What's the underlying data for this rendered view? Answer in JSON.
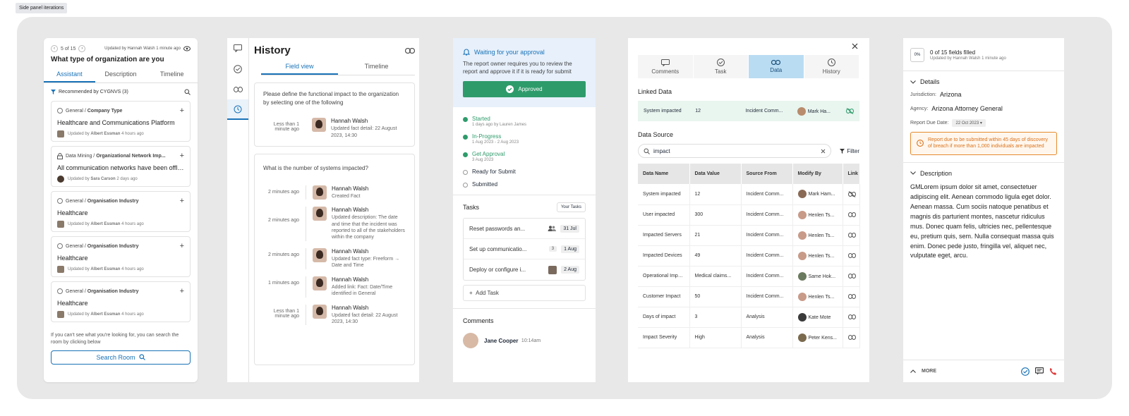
{
  "canvas": {
    "label": "Side panel iterations"
  },
  "panel1": {
    "pager": "5 of 15",
    "updated": "Updated by Hannah Walsh 1 minute ago",
    "title": "What type of organization are you",
    "tabs": [
      "Assistant",
      "Description",
      "Timeline"
    ],
    "recommended": "Recommended by CYGNVS (3)",
    "cards": [
      {
        "category": "General",
        "field": "Company Type",
        "value": "Healthcare and Communications Platform",
        "updated_prefix": "Updated by",
        "user": "Albert Essman",
        "when": "4 hours ago"
      },
      {
        "category": "Data Mining",
        "field": "Organizational Network Imp...",
        "value": "All communication networks have been offlin...",
        "updated_prefix": "Updated by",
        "user": "Sara Carson",
        "when": "2 days ago"
      },
      {
        "category": "General",
        "field": "Organisation Industry",
        "value": "Healthcare",
        "updated_prefix": "Updated by",
        "user": "Albert Essman",
        "when": "4 hours ago"
      },
      {
        "category": "General",
        "field": "Organisation Industry",
        "value": "Healthcare",
        "updated_prefix": "Updated by",
        "user": "Albert Essman",
        "when": "4 hours ago"
      },
      {
        "category": "General",
        "field": "Organisation Industry",
        "value": "Healthcare",
        "updated_prefix": "Updated by",
        "user": "Albert Essman",
        "when": "4 hours ago"
      }
    ],
    "footer_text": "If you can't see what you're looking for, you can search the room by clicking below",
    "search_room": "Search Room"
  },
  "panel2": {
    "title": "History",
    "tabs": [
      "Field view",
      "Timeline"
    ],
    "box1": {
      "question": "Please define the functional impact to the organization by selecting one of the following",
      "entries": [
        {
          "when": "Less than 1 minute ago",
          "name": "Hannah Walsh",
          "desc": "Updated fact detail: 22 August 2023, 14:30"
        }
      ]
    },
    "box2": {
      "question": "What is the number of systems impacted?",
      "entries": [
        {
          "when": "2 minutes ago",
          "name": "Hannah Walsh",
          "desc": "Created Fact"
        },
        {
          "when": "2 minutes ago",
          "name": "Hannah Walsh",
          "desc": "Updated description: The date and time that the incident was reported to all of the stakeholders within the company"
        },
        {
          "when": "2 minutes ago",
          "name": "Hannah Walsh",
          "desc": "Updated fact type: Freeform → Date and Time"
        },
        {
          "when": "1 minutes ago",
          "name": "Hannah Walsh",
          "desc": "Added link: Fact: Date/Time identified in General"
        },
        {
          "when": "Less than 1 minute ago",
          "name": "Hannah Walsh",
          "desc": "Updated fact detail: 22 August 2023, 14:30"
        }
      ]
    }
  },
  "panel3": {
    "wait_title": "Waiting for your approval",
    "wait_desc": "The report owner requires you to review the report and approve it if it is ready for submit",
    "approved": "Approved",
    "steps": [
      {
        "label": "Started",
        "sub": "1 days ago by Lauren James",
        "done": true
      },
      {
        "label": "In-Progress",
        "sub": "1 Aug 2023 - 2 Aug 2023",
        "done": true
      },
      {
        "label": "Get Approval",
        "sub": "3 Aug 2023",
        "done": true
      },
      {
        "label": "Ready for Submit",
        "sub": "",
        "done": false
      },
      {
        "label": "Submitted",
        "sub": "",
        "done": false
      }
    ],
    "tasks_title": "Tasks",
    "your_tasks": "Your Tasks",
    "tasks": [
      {
        "name": "Reset passwords an...",
        "meta": "",
        "date": "31 Jul"
      },
      {
        "name": "Set up communicatio...",
        "meta": "3",
        "date": "1 Aug"
      },
      {
        "name": "Deploy or configure i...",
        "meta": "",
        "date": "2 Aug"
      }
    ],
    "add_task": "Add Task",
    "comments_title": "Comments",
    "comment": {
      "name": "Jane Cooper",
      "time": "10:14am"
    }
  },
  "panel4": {
    "tabs": [
      "Comments",
      "Task",
      "Data",
      "History"
    ],
    "linked_title": "Linked Data",
    "linked": {
      "name": "System impacted",
      "value": "12",
      "source": "Incident Comm...",
      "user": "Mark Ha..."
    },
    "source_title": "Data Source",
    "search_value": "impact",
    "filter": "Filter",
    "columns": [
      "Data Name",
      "Data Value",
      "Source From",
      "Modify By",
      "Link"
    ],
    "rows": [
      {
        "name": "System impacted",
        "value": "12",
        "source": "Incident Comm...",
        "user": "Mark Ham..."
      },
      {
        "name": "User impacted",
        "value": "300",
        "source": "Incident Comm...",
        "user": "Henlen Ts..."
      },
      {
        "name": "Impacted Servers",
        "value": "21",
        "source": "Incident Comm...",
        "user": "Henlen Ts..."
      },
      {
        "name": "Impacted Devices",
        "value": "49",
        "source": "Incident Comm...",
        "user": "Henlen Ts..."
      },
      {
        "name": "Operational Impact",
        "value": "Medical claims...",
        "source": "Incident Comm...",
        "user": "Same Hok..."
      },
      {
        "name": "Customer Impact",
        "value": "50",
        "source": "Incident Comm...",
        "user": "Henlen Ts..."
      },
      {
        "name": "Days of impact",
        "value": "3",
        "source": "Analysis",
        "user": "Kate Mote"
      },
      {
        "name": "Impact Severity",
        "value": "High",
        "source": "Analysis",
        "user": "Peter Kens..."
      }
    ]
  },
  "panel5": {
    "pct": "0%",
    "filled": "0 of 15 fields filled",
    "updated": "Updated by Hannah Walsh 1 minute ago",
    "details_title": "Details",
    "jurisdiction_label": "Jurisdiction:",
    "jurisdiction": "Arizona",
    "agency_label": "Agency:",
    "agency": "Arizona Attorney General",
    "due_label": "Report Due Date:",
    "due_date": "22 Oct 2023",
    "warning": "Report due to be submitted within 45 days of discovery of breach if more than 1,000 individuals are impacted",
    "description_title": "Description",
    "description": "GMLorem ipsum dolor sit amet, consectetuer adipiscing elit. Aenean commodo ligula eget dolor. Aenean massa. Cum sociis natoque penatibus et magnis dis parturient montes, nascetur ridiculus mus. Donec quam felis, ultricies nec, pellentesque eu, pretium quis, sem. Nulla consequat massa quis enim. Donec pede justo, fringilla vel, aliquet nec, vulputate eget, arcu.",
    "more": "MORE"
  },
  "colors": {
    "accent": "#1a73b8",
    "success": "#2e9b6b",
    "warning": "#e68a2e",
    "call": "#e03b3b"
  }
}
